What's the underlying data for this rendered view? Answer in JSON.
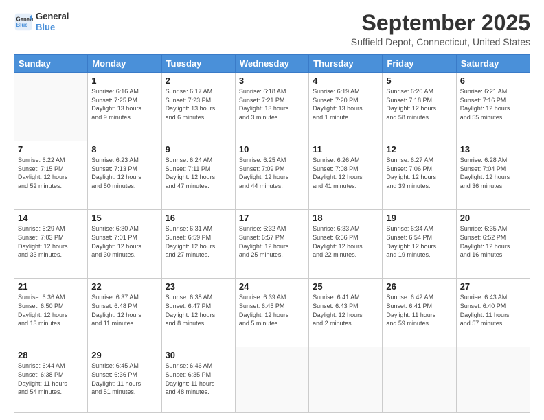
{
  "header": {
    "logo_line1": "General",
    "logo_line2": "Blue",
    "title": "September 2025",
    "subtitle": "Suffield Depot, Connecticut, United States"
  },
  "calendar": {
    "days_of_week": [
      "Sunday",
      "Monday",
      "Tuesday",
      "Wednesday",
      "Thursday",
      "Friday",
      "Saturday"
    ],
    "weeks": [
      [
        {
          "day": "",
          "info": ""
        },
        {
          "day": "1",
          "info": "Sunrise: 6:16 AM\nSunset: 7:25 PM\nDaylight: 13 hours\nand 9 minutes."
        },
        {
          "day": "2",
          "info": "Sunrise: 6:17 AM\nSunset: 7:23 PM\nDaylight: 13 hours\nand 6 minutes."
        },
        {
          "day": "3",
          "info": "Sunrise: 6:18 AM\nSunset: 7:21 PM\nDaylight: 13 hours\nand 3 minutes."
        },
        {
          "day": "4",
          "info": "Sunrise: 6:19 AM\nSunset: 7:20 PM\nDaylight: 13 hours\nand 1 minute."
        },
        {
          "day": "5",
          "info": "Sunrise: 6:20 AM\nSunset: 7:18 PM\nDaylight: 12 hours\nand 58 minutes."
        },
        {
          "day": "6",
          "info": "Sunrise: 6:21 AM\nSunset: 7:16 PM\nDaylight: 12 hours\nand 55 minutes."
        }
      ],
      [
        {
          "day": "7",
          "info": "Sunrise: 6:22 AM\nSunset: 7:15 PM\nDaylight: 12 hours\nand 52 minutes."
        },
        {
          "day": "8",
          "info": "Sunrise: 6:23 AM\nSunset: 7:13 PM\nDaylight: 12 hours\nand 50 minutes."
        },
        {
          "day": "9",
          "info": "Sunrise: 6:24 AM\nSunset: 7:11 PM\nDaylight: 12 hours\nand 47 minutes."
        },
        {
          "day": "10",
          "info": "Sunrise: 6:25 AM\nSunset: 7:09 PM\nDaylight: 12 hours\nand 44 minutes."
        },
        {
          "day": "11",
          "info": "Sunrise: 6:26 AM\nSunset: 7:08 PM\nDaylight: 12 hours\nand 41 minutes."
        },
        {
          "day": "12",
          "info": "Sunrise: 6:27 AM\nSunset: 7:06 PM\nDaylight: 12 hours\nand 39 minutes."
        },
        {
          "day": "13",
          "info": "Sunrise: 6:28 AM\nSunset: 7:04 PM\nDaylight: 12 hours\nand 36 minutes."
        }
      ],
      [
        {
          "day": "14",
          "info": "Sunrise: 6:29 AM\nSunset: 7:03 PM\nDaylight: 12 hours\nand 33 minutes."
        },
        {
          "day": "15",
          "info": "Sunrise: 6:30 AM\nSunset: 7:01 PM\nDaylight: 12 hours\nand 30 minutes."
        },
        {
          "day": "16",
          "info": "Sunrise: 6:31 AM\nSunset: 6:59 PM\nDaylight: 12 hours\nand 27 minutes."
        },
        {
          "day": "17",
          "info": "Sunrise: 6:32 AM\nSunset: 6:57 PM\nDaylight: 12 hours\nand 25 minutes."
        },
        {
          "day": "18",
          "info": "Sunrise: 6:33 AM\nSunset: 6:56 PM\nDaylight: 12 hours\nand 22 minutes."
        },
        {
          "day": "19",
          "info": "Sunrise: 6:34 AM\nSunset: 6:54 PM\nDaylight: 12 hours\nand 19 minutes."
        },
        {
          "day": "20",
          "info": "Sunrise: 6:35 AM\nSunset: 6:52 PM\nDaylight: 12 hours\nand 16 minutes."
        }
      ],
      [
        {
          "day": "21",
          "info": "Sunrise: 6:36 AM\nSunset: 6:50 PM\nDaylight: 12 hours\nand 13 minutes."
        },
        {
          "day": "22",
          "info": "Sunrise: 6:37 AM\nSunset: 6:48 PM\nDaylight: 12 hours\nand 11 minutes."
        },
        {
          "day": "23",
          "info": "Sunrise: 6:38 AM\nSunset: 6:47 PM\nDaylight: 12 hours\nand 8 minutes."
        },
        {
          "day": "24",
          "info": "Sunrise: 6:39 AM\nSunset: 6:45 PM\nDaylight: 12 hours\nand 5 minutes."
        },
        {
          "day": "25",
          "info": "Sunrise: 6:41 AM\nSunset: 6:43 PM\nDaylight: 12 hours\nand 2 minutes."
        },
        {
          "day": "26",
          "info": "Sunrise: 6:42 AM\nSunset: 6:41 PM\nDaylight: 11 hours\nand 59 minutes."
        },
        {
          "day": "27",
          "info": "Sunrise: 6:43 AM\nSunset: 6:40 PM\nDaylight: 11 hours\nand 57 minutes."
        }
      ],
      [
        {
          "day": "28",
          "info": "Sunrise: 6:44 AM\nSunset: 6:38 PM\nDaylight: 11 hours\nand 54 minutes."
        },
        {
          "day": "29",
          "info": "Sunrise: 6:45 AM\nSunset: 6:36 PM\nDaylight: 11 hours\nand 51 minutes."
        },
        {
          "day": "30",
          "info": "Sunrise: 6:46 AM\nSunset: 6:35 PM\nDaylight: 11 hours\nand 48 minutes."
        },
        {
          "day": "",
          "info": ""
        },
        {
          "day": "",
          "info": ""
        },
        {
          "day": "",
          "info": ""
        },
        {
          "day": "",
          "info": ""
        }
      ]
    ]
  }
}
